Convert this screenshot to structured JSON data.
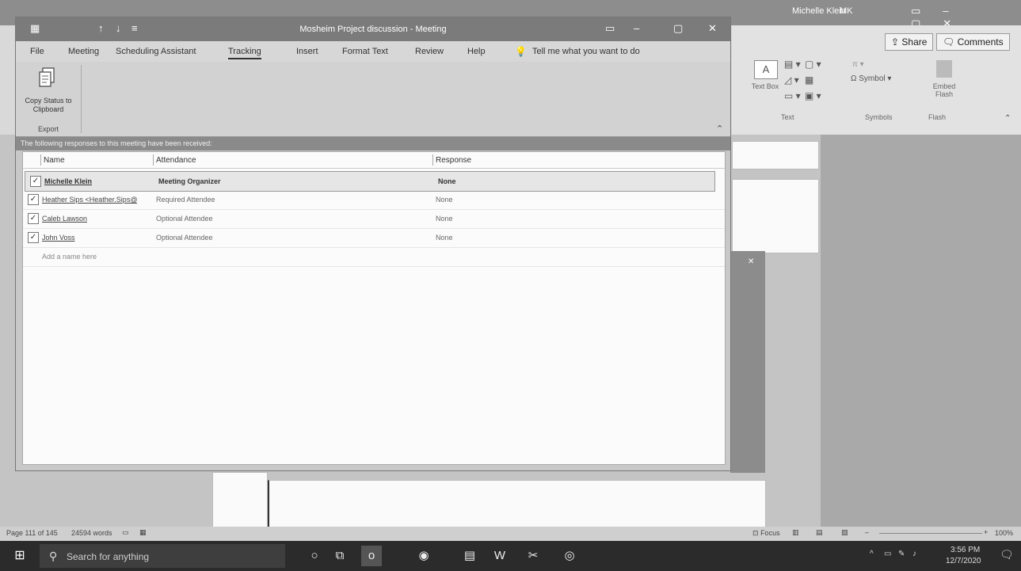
{
  "word": {
    "user_name": "Michelle Klein",
    "user_initials": "MK",
    "share_label": "Share",
    "comments_label": "Comments",
    "text_box_label": "Text Box",
    "symbol_label": "Symbol",
    "embed_flash_label": "Embed Flash",
    "group_text": "Text",
    "group_symbols": "Symbols",
    "group_flash": "Flash",
    "status_page": "Page 111 of 145",
    "status_words": "24594 words",
    "status_focus": "Focus",
    "status_zoom": "100%"
  },
  "meeting": {
    "title": "Mosheim Project discussion - Meeting",
    "tabs": [
      {
        "label": "File"
      },
      {
        "label": "Meeting"
      },
      {
        "label": "Scheduling Assistant"
      },
      {
        "label": "Tracking"
      },
      {
        "label": "Insert"
      },
      {
        "label": "Format Text"
      },
      {
        "label": "Review"
      },
      {
        "label": "Help"
      }
    ],
    "tell_me": "Tell me what you want to do",
    "ribbon": {
      "copy_status_label": "Copy Status to Clipboard",
      "group_export": "Export"
    },
    "info_bar": "The following responses to this meeting have been received:",
    "grid": {
      "columns": [
        "Name",
        "Attendance",
        "Response"
      ],
      "rows": [
        {
          "checked": true,
          "name": "Michelle Klein",
          "attendance": "Meeting Organizer",
          "response": "None"
        },
        {
          "checked": true,
          "name": "Heather Sips <Heather.Sips@",
          "attendance": "Required Attendee",
          "response": "None"
        },
        {
          "checked": true,
          "name": "Caleb Lawson",
          "attendance": "Optional Attendee",
          "response": "None"
        },
        {
          "checked": true,
          "name": "John Voss",
          "attendance": "Optional Attendee",
          "response": "None"
        }
      ],
      "add_placeholder": "Add a name here"
    }
  },
  "taskbar": {
    "search_placeholder": "Search for anything",
    "time": "3:56 PM",
    "date": "12/7/2020"
  }
}
